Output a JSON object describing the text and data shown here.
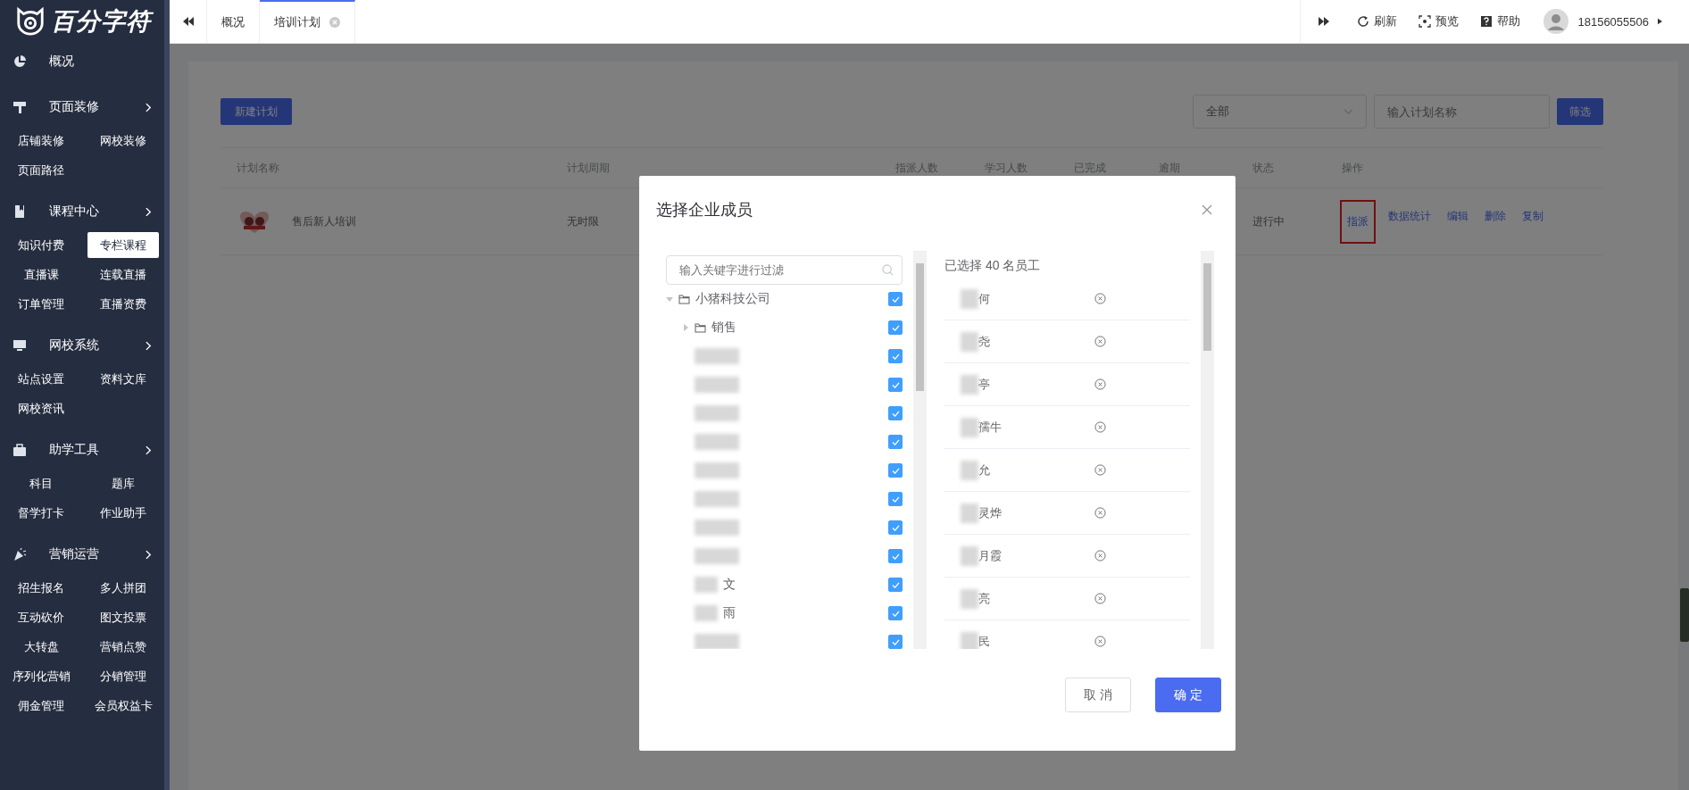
{
  "brand": {
    "name": "百分字符"
  },
  "sidebar": {
    "sections": [
      {
        "title": "概况",
        "expandable": false
      },
      {
        "title": "页面装修",
        "expandable": true,
        "items": [
          {
            "label": "店铺装修",
            "selected": false
          },
          {
            "label": "网校装修",
            "selected": false
          },
          {
            "label": "页面路径",
            "selected": false
          }
        ]
      },
      {
        "title": "课程中心",
        "expandable": true,
        "items": [
          {
            "label": "知识付费",
            "selected": false
          },
          {
            "label": "专栏课程",
            "selected": true
          },
          {
            "label": "直播课",
            "selected": false
          },
          {
            "label": "连载直播",
            "selected": false
          },
          {
            "label": "订单管理",
            "selected": false
          },
          {
            "label": "直播资费",
            "selected": false
          }
        ]
      },
      {
        "title": "网校系统",
        "expandable": true,
        "items": [
          {
            "label": "站点设置",
            "selected": false
          },
          {
            "label": "资料文库",
            "selected": false
          },
          {
            "label": "网校资讯",
            "selected": false
          }
        ]
      },
      {
        "title": "助学工具",
        "expandable": true,
        "items": [
          {
            "label": "科目",
            "selected": false
          },
          {
            "label": "题库",
            "selected": false
          },
          {
            "label": "督学打卡",
            "selected": false
          },
          {
            "label": "作业助手",
            "selected": false
          }
        ]
      },
      {
        "title": "营销运营",
        "expandable": true,
        "items": [
          {
            "label": "招生报名",
            "selected": false
          },
          {
            "label": "多人拼团",
            "selected": false
          },
          {
            "label": "互动砍价",
            "selected": false
          },
          {
            "label": "图文投票",
            "selected": false
          },
          {
            "label": "大转盘",
            "selected": false
          },
          {
            "label": "营销点赞",
            "selected": false
          },
          {
            "label": "序列化营销",
            "selected": false
          },
          {
            "label": "分销管理",
            "selected": false
          },
          {
            "label": "佣金管理",
            "selected": false
          },
          {
            "label": "会员权益卡",
            "selected": false
          }
        ]
      }
    ]
  },
  "tabs": [
    {
      "label": "概况",
      "selected": false,
      "closable": false
    },
    {
      "label": "培训计划",
      "selected": true,
      "closable": true
    }
  ],
  "header_actions": [
    {
      "label": "刷新"
    },
    {
      "label": "预览"
    },
    {
      "label": "帮助"
    }
  ],
  "user": {
    "name": "18156055506"
  },
  "toolbar": {
    "new_button": "新建计划",
    "status_select": {
      "value": "全部"
    },
    "search": {
      "placeholder": "输入计划名称"
    },
    "filter_button": "筛选"
  },
  "table": {
    "columns": [
      "计划名称",
      "计划周期",
      "指派人数",
      "学习人数",
      "已完成",
      "逾期",
      "状态",
      "操作"
    ],
    "rows": [
      {
        "name": "售后新人培训",
        "period": "无时限",
        "status": "进行中",
        "actions": [
          {
            "label": "指派",
            "highlighted": true
          },
          {
            "label": "数据统计",
            "highlighted": false
          },
          {
            "label": "编辑",
            "highlighted": false
          },
          {
            "label": "删除",
            "highlighted": false
          },
          {
            "label": "复制",
            "highlighted": false
          }
        ]
      }
    ]
  },
  "modal": {
    "title": "选择企业成员",
    "filter": {
      "placeholder": "输入关键字进行过滤"
    },
    "tree": [
      {
        "kind": "folder",
        "label": "小猪科技公司",
        "expanded": true,
        "checked": true,
        "children": [
          {
            "kind": "folder",
            "label": "销售",
            "expanded": false,
            "checked": true
          },
          {
            "kind": "blurred",
            "checked": true
          },
          {
            "kind": "blurred",
            "checked": true
          },
          {
            "kind": "blurred",
            "checked": true
          },
          {
            "kind": "blurred",
            "checked": true
          },
          {
            "kind": "blurred",
            "checked": true
          },
          {
            "kind": "blurred",
            "checked": true
          },
          {
            "kind": "blurred",
            "checked": true
          },
          {
            "kind": "blurred",
            "checked": true
          },
          {
            "kind": "person",
            "label": "文",
            "checked": true
          },
          {
            "kind": "person",
            "label": "雨",
            "checked": true
          },
          {
            "kind": "blurred",
            "checked": true
          }
        ]
      }
    ],
    "selected_header": "已选择 40 名员工",
    "selected": [
      {
        "name": "何",
        "redacted": true
      },
      {
        "name": "尧",
        "redacted": true
      },
      {
        "name": "亭",
        "redacted": true
      },
      {
        "name": "孺牛",
        "redacted": true
      },
      {
        "name": "允",
        "redacted": true
      },
      {
        "name": "灵烨",
        "redacted": true
      },
      {
        "name": "月霞",
        "redacted": true
      },
      {
        "name": "亮",
        "redacted": true
      },
      {
        "name": "民",
        "redacted": true
      }
    ],
    "buttons": {
      "cancel": "取 消",
      "confirm": "确 定"
    }
  }
}
